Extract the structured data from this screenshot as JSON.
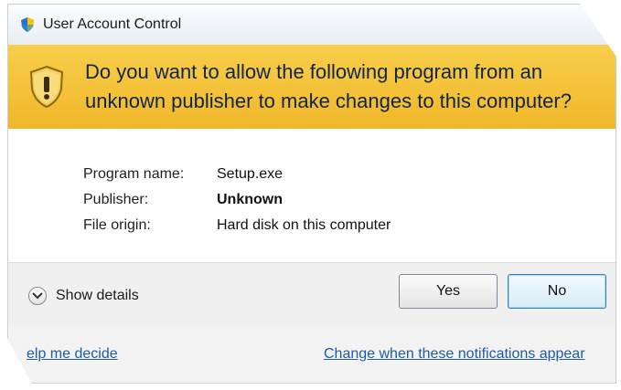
{
  "window": {
    "title": "User Account Control",
    "title_icon": "uac-shield-icon"
  },
  "banner": {
    "icon": "warning-shield-icon",
    "question": "Do you want to allow the following program from an unknown publisher to make changes to this computer?",
    "background_color": "#f5c23c"
  },
  "program_info": {
    "rows": [
      {
        "label": "Program name:",
        "value": "Setup.exe"
      },
      {
        "label": "Publisher:",
        "value": "Unknown"
      },
      {
        "label": "File origin:",
        "value": "Hard disk on this computer"
      }
    ]
  },
  "footer": {
    "show_details_label": "Show details",
    "show_details_icon": "chevron-down-icon",
    "yes_label": "Yes",
    "no_label": "No"
  },
  "links": {
    "help_label": "elp me decide",
    "change_notifications_label": "Change when these notifications appear",
    "link_color": "#1e5aa8"
  }
}
